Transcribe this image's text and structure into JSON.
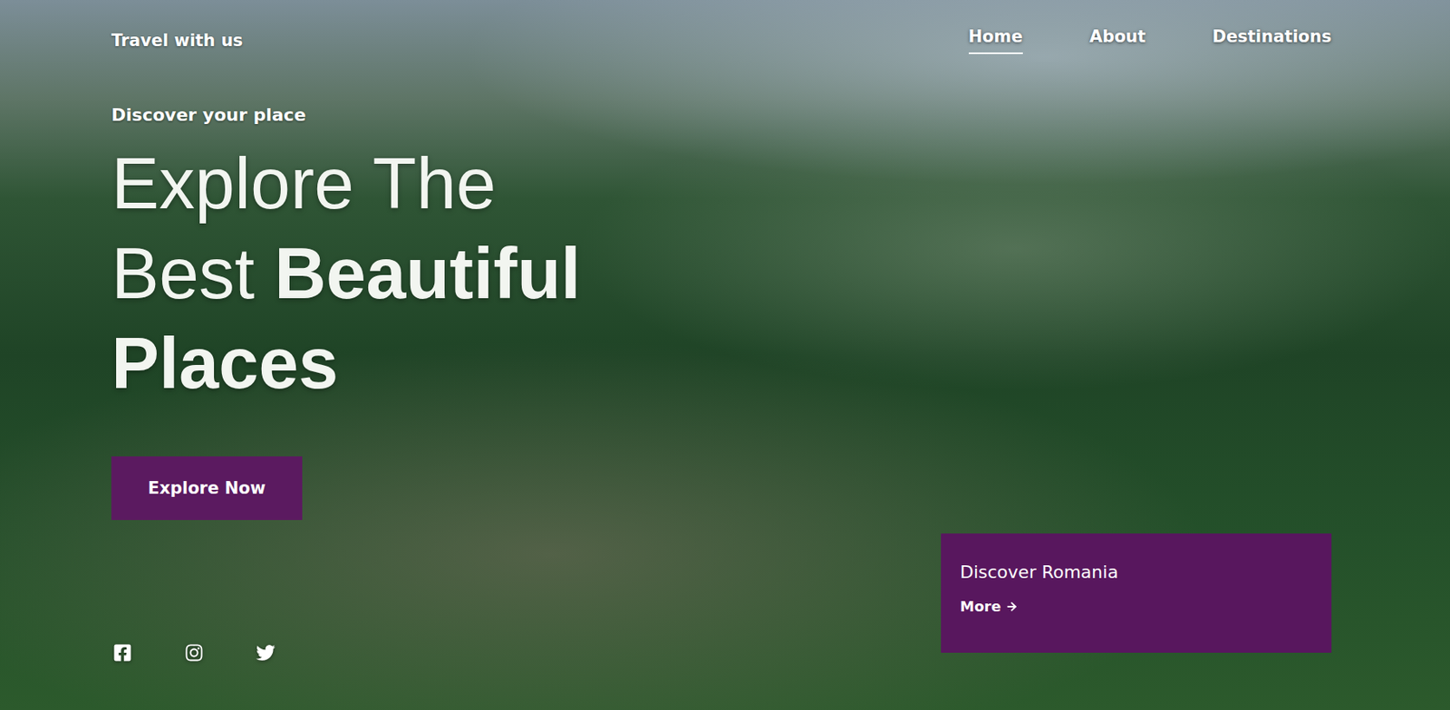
{
  "brand": "Travel with us",
  "nav": [
    {
      "label": "Home",
      "selected": true
    },
    {
      "label": "About",
      "selected": false
    },
    {
      "label": "Destinations",
      "selected": false
    }
  ],
  "hero": {
    "tagline": "Discover your place",
    "heading": [
      [
        {
          "text": "Explore The",
          "bold": false
        }
      ],
      [
        {
          "text": "Best",
          "bold": false
        },
        {
          "text": "Beautiful",
          "bold": true
        }
      ],
      [
        {
          "text": "Places",
          "bold": true
        }
      ]
    ],
    "button": "Explore Now"
  },
  "social": [
    {
      "kind": "facebook"
    },
    {
      "kind": "instagram"
    },
    {
      "kind": "twitter"
    }
  ],
  "card": {
    "title": "Discover Romania",
    "link": "More"
  }
}
